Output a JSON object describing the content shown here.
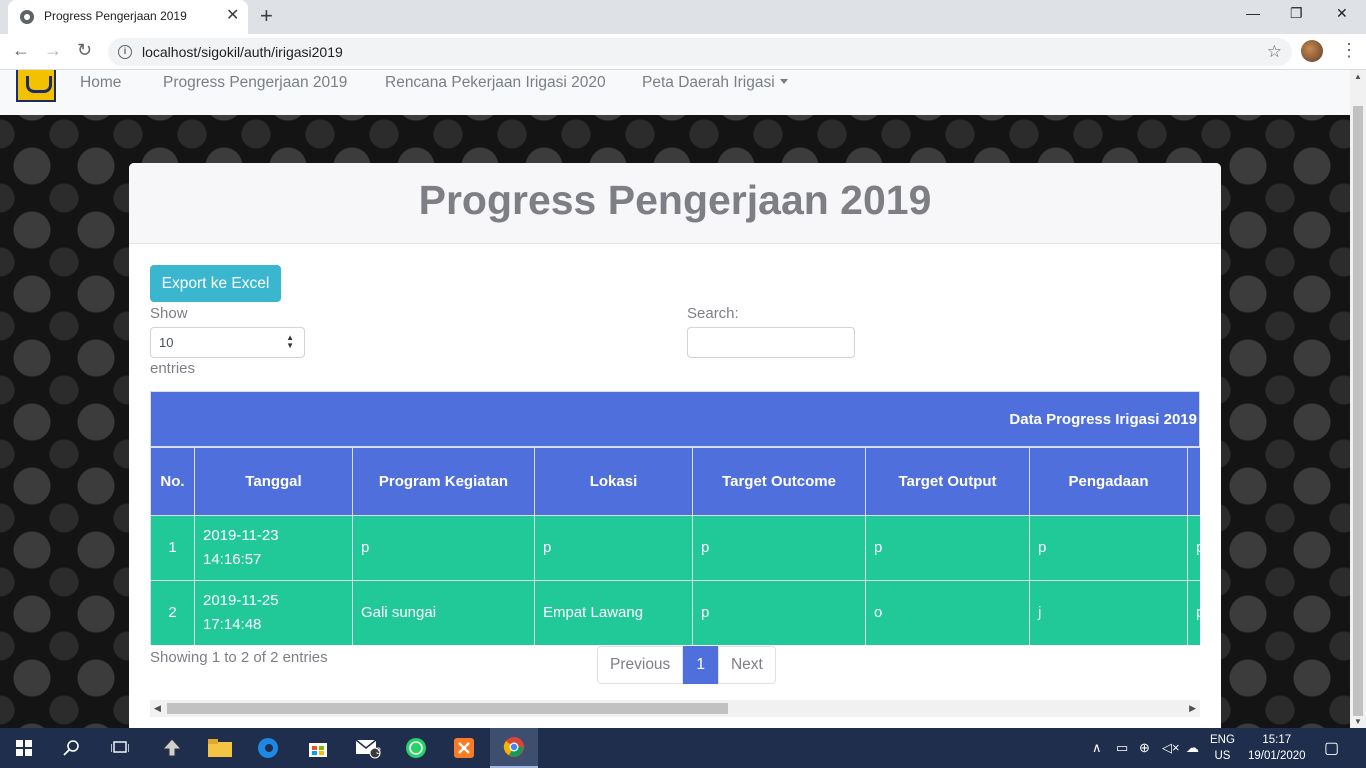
{
  "browser": {
    "tab_title": "Progress Pengerjaan 2019",
    "tab_close": "✕",
    "new_tab": "+",
    "url": "localhost/sigokil/auth/irigasi2019",
    "window_controls": {
      "minimize": "—",
      "maximize": "❐",
      "close": "✕"
    },
    "nav": {
      "back": "←",
      "forward": "→",
      "reload": "↻"
    }
  },
  "navbar": {
    "items": [
      {
        "label": "Home"
      },
      {
        "label": "Progress Pengerjaan 2019"
      },
      {
        "label": "Rencana Pekerjaan Irigasi 2020"
      },
      {
        "label": "Peta Daerah Irigasi"
      }
    ]
  },
  "card": {
    "title": "Progress Pengerjaan 2019",
    "export_label": "Export ke Excel",
    "show_label": "Show",
    "entries_value": "10",
    "entries_label": "entries",
    "search_label": "Search:",
    "search_value": ""
  },
  "table": {
    "group_title": "Data Progress Irigasi 2019",
    "columns": [
      "No.",
      "Tanggal",
      "Program Kegiatan",
      "Lokasi",
      "Target Outcome",
      "Target Output",
      "Pengadaan"
    ],
    "rows": [
      {
        "no": "1",
        "tanggal": "2019-11-23\n14:16:57",
        "program": "p",
        "lokasi": "p",
        "outcome": "p",
        "output": "p",
        "pengadaan": "p",
        "next": "p"
      },
      {
        "no": "2",
        "tanggal": "2019-11-25\n17:14:48",
        "program": "Gali sungai",
        "lokasi": "Empat Lawang",
        "outcome": "p",
        "output": "o",
        "pengadaan": "j",
        "next": "p"
      }
    ]
  },
  "pagination": {
    "info": "Showing 1 to 2 of 2 entries",
    "previous": "Previous",
    "current": "1",
    "next": "Next"
  },
  "taskbar": {
    "language": [
      "ENG",
      "US"
    ],
    "time": "15:17",
    "date": "19/01/2020",
    "mail_badge": "3"
  },
  "colors": {
    "header_blue": "#4f6fdc",
    "row_green": "#20c997",
    "export_button": "#3ab7cf"
  }
}
